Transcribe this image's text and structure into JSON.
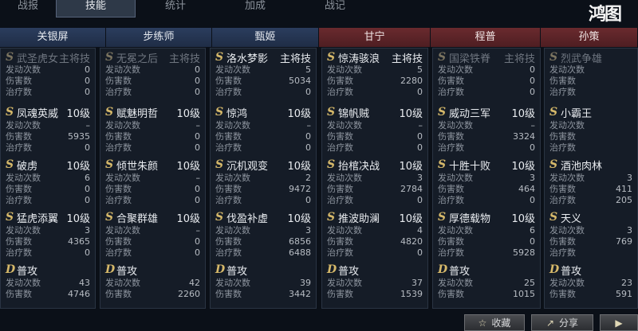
{
  "tabs": [
    {
      "label": "战报"
    },
    {
      "label": "技能"
    },
    {
      "label": "统计"
    },
    {
      "label": "加成"
    },
    {
      "label": "战记"
    }
  ],
  "watermark": "鸿图",
  "generals": [
    {
      "name": "关银屏",
      "side": "blue"
    },
    {
      "name": "步练师",
      "side": "blue"
    },
    {
      "name": "甄姬",
      "side": "blue"
    },
    {
      "name": "甘宁",
      "side": "red"
    },
    {
      "name": "程普",
      "side": "red"
    },
    {
      "name": "孙策",
      "side": "red"
    }
  ],
  "stat_labels": {
    "trigger": "发动次数",
    "damage": "伤害数",
    "heal": "治疗数"
  },
  "columns": [
    {
      "skills": [
        {
          "letter": "S",
          "name": "武圣虎女",
          "level": "主将技",
          "dim": true,
          "trigger": "0",
          "damage": "0",
          "heal": "0"
        },
        {
          "letter": "S",
          "name": "凤魂英威",
          "level": "10级",
          "trigger": "–",
          "damage": "5935",
          "heal": "0"
        },
        {
          "letter": "S",
          "name": "破虏",
          "level": "10级",
          "trigger": "6",
          "damage": "0",
          "heal": "0"
        },
        {
          "letter": "S",
          "name": "猛虎添翼",
          "level": "10级",
          "trigger": "3",
          "damage": "4365",
          "heal": "0"
        },
        {
          "letter": "D",
          "name": "普攻",
          "level": "",
          "trigger": "43",
          "damage": "4746"
        }
      ]
    },
    {
      "skills": [
        {
          "letter": "S",
          "name": "无冕之后",
          "level": "主将技",
          "dim": true,
          "trigger": "0",
          "damage": "0",
          "heal": "0"
        },
        {
          "letter": "S",
          "name": "赋魅明哲",
          "level": "10级",
          "trigger": "–",
          "damage": "0",
          "heal": "0"
        },
        {
          "letter": "S",
          "name": "倾世朱颜",
          "level": "10级",
          "trigger": "–",
          "damage": "0",
          "heal": "0"
        },
        {
          "letter": "S",
          "name": "合聚群雄",
          "level": "10级",
          "trigger": "–",
          "damage": "0",
          "heal": "0"
        },
        {
          "letter": "D",
          "name": "普攻",
          "level": "",
          "trigger": "42",
          "damage": "2260"
        }
      ]
    },
    {
      "skills": [
        {
          "letter": "S",
          "name": "洛水梦影",
          "level": "主将技",
          "trigger": "5",
          "damage": "5034",
          "heal": "0"
        },
        {
          "letter": "S",
          "name": "惊鸿",
          "level": "10级",
          "trigger": "–",
          "damage": "0",
          "heal": "0"
        },
        {
          "letter": "S",
          "name": "沉机观变",
          "level": "10级",
          "trigger": "2",
          "damage": "9472",
          "heal": "0"
        },
        {
          "letter": "S",
          "name": "伐盈补虚",
          "level": "10级",
          "trigger": "3",
          "damage": "6856",
          "heal": "6488"
        },
        {
          "letter": "D",
          "name": "普攻",
          "level": "",
          "trigger": "39",
          "damage": "3442"
        }
      ]
    },
    {
      "skills": [
        {
          "letter": "S",
          "name": "惊涛骇浪",
          "level": "主将技",
          "trigger": "5",
          "damage": "2280",
          "heal": "0"
        },
        {
          "letter": "S",
          "name": "锦帆贼",
          "level": "10级",
          "trigger": "–",
          "damage": "0",
          "heal": "0"
        },
        {
          "letter": "S",
          "name": "抬棺决战",
          "level": "10级",
          "trigger": "3",
          "damage": "2784",
          "heal": "0"
        },
        {
          "letter": "S",
          "name": "推波助澜",
          "level": "10级",
          "trigger": "4",
          "damage": "4820",
          "heal": "0"
        },
        {
          "letter": "D",
          "name": "普攻",
          "level": "",
          "trigger": "37",
          "damage": "1539"
        }
      ]
    },
    {
      "skills": [
        {
          "letter": "S",
          "name": "国梁铁脊",
          "level": "主将技",
          "dim": true,
          "trigger": "0",
          "damage": "0",
          "heal": "0"
        },
        {
          "letter": "S",
          "name": "威动三军",
          "level": "10级",
          "trigger": "–",
          "damage": "3324",
          "heal": "0"
        },
        {
          "letter": "S",
          "name": "十胜十败",
          "level": "10级",
          "trigger": "3",
          "damage": "464",
          "heal": "0"
        },
        {
          "letter": "S",
          "name": "厚德载物",
          "level": "10级",
          "trigger": "6",
          "damage": "0",
          "heal": "5928"
        },
        {
          "letter": "D",
          "name": "普攻",
          "level": "",
          "trigger": "25",
          "damage": "1015"
        }
      ]
    },
    {
      "skills": [
        {
          "letter": "S",
          "name": "烈武争雄",
          "level": "",
          "dim": true,
          "trigger": "",
          "damage": "",
          "heal": ""
        },
        {
          "letter": "S",
          "name": "小霸王",
          "level": "",
          "trigger": "",
          "damage": "",
          "heal": ""
        },
        {
          "letter": "S",
          "name": "酒池肉林",
          "level": "",
          "trigger": "3",
          "damage": "411",
          "heal": "205"
        },
        {
          "letter": "S",
          "name": "天义",
          "level": "",
          "trigger": "3",
          "damage": "769",
          "heal": ""
        },
        {
          "letter": "D",
          "name": "普攻",
          "level": "",
          "trigger": "23",
          "damage": "591"
        }
      ]
    }
  ],
  "buttons": [
    {
      "label": "收藏",
      "icon": "star-icon"
    },
    {
      "label": "分享",
      "icon": "share-icon"
    },
    {
      "label": "",
      "icon": "replay-icon"
    }
  ]
}
